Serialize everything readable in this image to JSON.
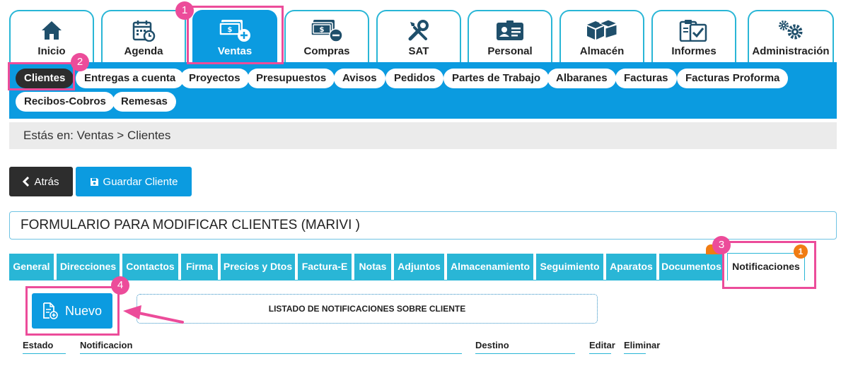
{
  "modules": [
    {
      "label": "Inicio",
      "icon": "home-icon"
    },
    {
      "label": "Agenda",
      "icon": "calendar-icon"
    },
    {
      "label": "Ventas",
      "icon": "money-plus-icon"
    },
    {
      "label": "Compras",
      "icon": "money-minus-icon"
    },
    {
      "label": "SAT",
      "icon": "tools-icon"
    },
    {
      "label": "Personal",
      "icon": "id-card-icon"
    },
    {
      "label": "Almacén",
      "icon": "boxes-icon"
    },
    {
      "label": "Informes",
      "icon": "clipboard-icon"
    },
    {
      "label": "Administración",
      "icon": "gears-icon"
    }
  ],
  "submenu": [
    "Clientes",
    "Entregas a cuenta",
    "Proyectos",
    "Presupuestos",
    "Avisos",
    "Pedidos",
    "Partes de Trabajo",
    "Albaranes",
    "Facturas",
    "Facturas Proforma",
    "Recibos-Cobros",
    "Remesas"
  ],
  "breadcrumb": "Estás en: Ventas > Clientes",
  "buttons": {
    "back": "Atrás",
    "save": "Guardar Cliente",
    "new": "Nuevo"
  },
  "form_title": "FORMULARIO PARA MODIFICAR CLIENTES (MARIVI )",
  "record_tabs": [
    "General",
    "Direcciones",
    "Contactos",
    "Firma",
    "Precios y Dtos",
    "Factura-E",
    "Notas",
    "Adjuntos",
    "Almacenamiento",
    "Seguimiento",
    "Aparatos",
    "Documentos",
    "Notificaciones"
  ],
  "notifications_badge": "1",
  "list_title": "LISTADO DE NOTIFICACIONES SOBRE CLIENTE",
  "columns": [
    "Estado",
    "Notificacion",
    "Destino",
    "Editar",
    "Eliminar"
  ],
  "annotations": [
    "1",
    "2",
    "3",
    "4"
  ],
  "colors": {
    "primary": "#0b9be0",
    "tab": "#29b6d6",
    "dark": "#2d2d2d",
    "highlight": "#ec4c9a",
    "badge": "#f07c13"
  }
}
